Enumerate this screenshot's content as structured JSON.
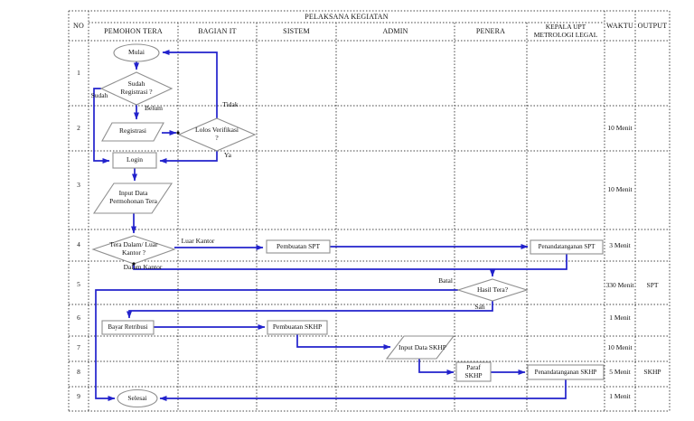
{
  "header": {
    "no": "NO",
    "pelaksana": "PELAKSANA KEGIATAN",
    "actors": [
      "PEMOHON TERA",
      "BAGIAN IT",
      "SISTEM",
      "ADMIN",
      "PENERA",
      "KEPALA UPT METROLOGI LEGAL"
    ],
    "waktu": "WAKTU",
    "output": "OUTPUT"
  },
  "rows": [
    {
      "no": "1",
      "waktu": "",
      "output": ""
    },
    {
      "no": "2",
      "waktu": "10 Menit",
      "output": ""
    },
    {
      "no": "3",
      "waktu": "10 Menit",
      "output": ""
    },
    {
      "no": "4",
      "waktu": "3 Menit",
      "output": ""
    },
    {
      "no": "5",
      "waktu": "330 Menit",
      "output": "SPT"
    },
    {
      "no": "6",
      "waktu": "1 Menit",
      "output": ""
    },
    {
      "no": "7",
      "waktu": "10 Menit",
      "output": ""
    },
    {
      "no": "8",
      "waktu": "5 Menit",
      "output": "SKHP"
    },
    {
      "no": "9",
      "waktu": "1 Menit",
      "output": ""
    }
  ],
  "nodes": {
    "mulai": "Mulai",
    "sudah_registrasi": "Sudah Registrasi ?",
    "registrasi": "Registrasi",
    "lolos_verifikasi": "Lolos Verifikasi ?",
    "login": "Login",
    "input_data_permohonan": "Input Data Permohonan Tera",
    "tera_dalam_luar": "Tera Dalam/ Luar Kantor ?",
    "pembuatan_spt": "Pembuatan SPT",
    "penandatanganan_spt": "Penandatanganan SPT",
    "hasil_tera": "Hasil Tera?",
    "bayar_retribusi": "Bayar Retribusi",
    "pembuatan_skhp": "Pembuatan SKHP",
    "input_data_skhp": "Input Data SKHP",
    "paraf_skhp": "Paraf SKHP",
    "penandatanganan_skhp": "Penandatanganan SKHP",
    "selesai": "Selesai"
  },
  "edge_labels": {
    "sudah": "Sudah",
    "belum": "Belum",
    "tidak": "Tidak",
    "ya": "Ya",
    "luar_kantor": "Luar Kantor",
    "dalam_kantor": "Dalam Kantor",
    "batal": "Batal",
    "sah": "Sah"
  },
  "colors": {
    "arrow": "#2222cc",
    "grid": "#444444",
    "shape_border": "#8f8f8f"
  }
}
